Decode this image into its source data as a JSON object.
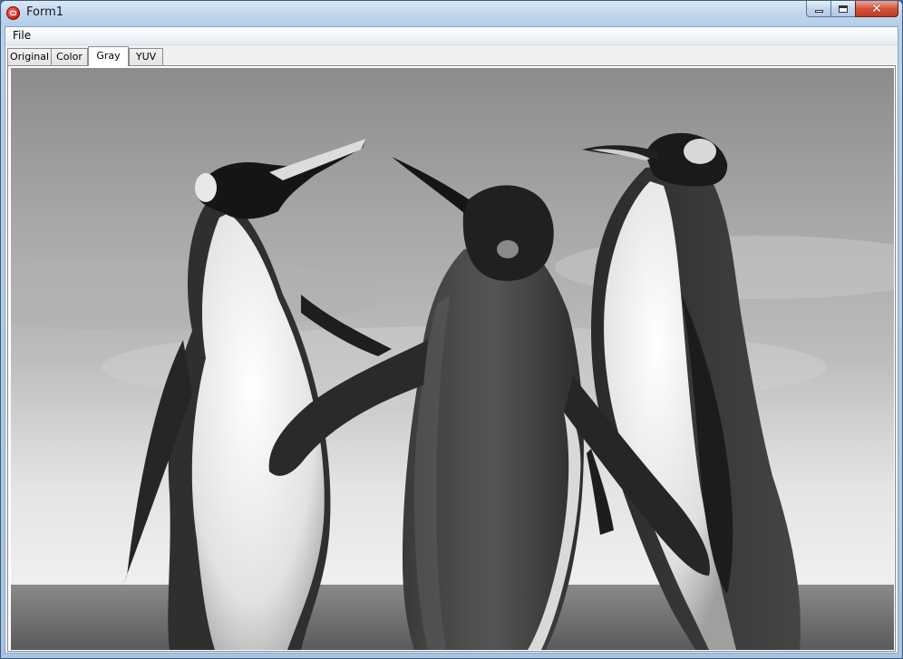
{
  "window": {
    "title": "Form1",
    "icon": "app-icon"
  },
  "menu": {
    "file": "File"
  },
  "tabs": [
    {
      "label": "Original",
      "active": false
    },
    {
      "label": "Color",
      "active": false
    },
    {
      "label": "Gray",
      "active": true
    },
    {
      "label": "YUV",
      "active": false
    }
  ],
  "caption_buttons": {
    "minimize_icon": "minimize-icon",
    "maximize_icon": "maximize-icon",
    "close_icon": "close-icon"
  },
  "picture": {
    "mode": "grayscale",
    "subject": "three-penguins"
  }
}
